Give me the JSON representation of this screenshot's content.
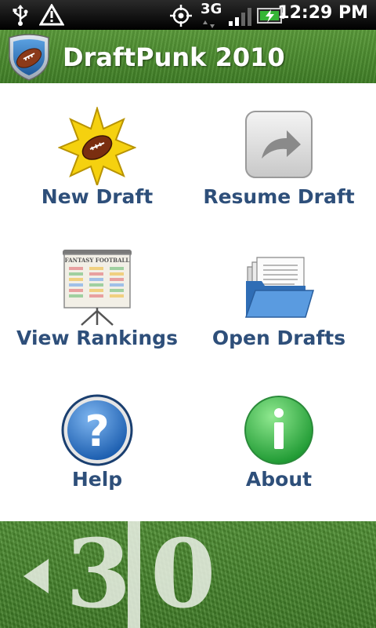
{
  "status_bar": {
    "network": "3G",
    "time": "12:29 PM"
  },
  "app": {
    "title": "DraftPunk 2010"
  },
  "menu": {
    "new_draft": "New Draft",
    "resume_draft": "Resume Draft",
    "view_rankings": "View Rankings",
    "open_drafts": "Open Drafts",
    "help": "Help",
    "about": "About"
  },
  "rankings_board_text": "FANTASY FOOTBALL",
  "footer": {
    "yard_number_left": "3",
    "yard_number_right": "0"
  },
  "colors": {
    "label": "#2e4f7a",
    "field_green": "#4a8a30",
    "status_bar": "#000000"
  }
}
